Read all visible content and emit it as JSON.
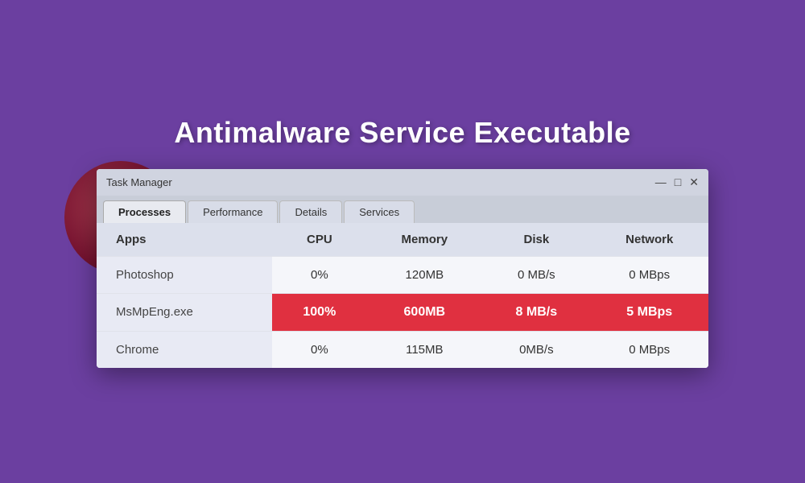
{
  "page": {
    "title": "Antimalware Service Executable",
    "background_color": "#6b3fa0"
  },
  "window": {
    "title": "Task Manager",
    "controls": {
      "minimize": "—",
      "maximize": "□",
      "close": "✕"
    }
  },
  "tabs": [
    {
      "label": "Processes",
      "active": true
    },
    {
      "label": "Performance",
      "active": false
    },
    {
      "label": "Details",
      "active": false
    },
    {
      "label": "Services",
      "active": false
    }
  ],
  "table": {
    "columns": [
      "Apps",
      "CPU",
      "Memory",
      "Disk",
      "Network"
    ],
    "rows": [
      {
        "name": "Photoshop",
        "cpu": "0%",
        "memory": "120MB",
        "disk": "0 MB/s",
        "network": "0 MBps",
        "highlight": false
      },
      {
        "name": "MsMpEng.exe",
        "cpu": "100%",
        "memory": "600MB",
        "disk": "8 MB/s",
        "network": "5 MBps",
        "highlight": true
      },
      {
        "name": "Chrome",
        "cpu": "0%",
        "memory": "115MB",
        "disk": "0MB/s",
        "network": "0 MBps",
        "highlight": false
      }
    ]
  }
}
